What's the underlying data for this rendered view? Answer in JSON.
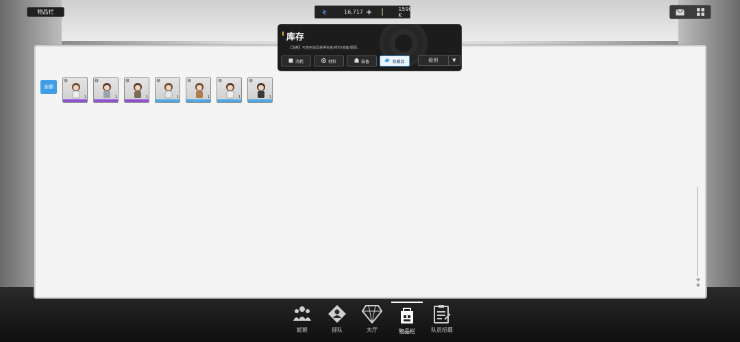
{
  "page_tag": "物品栏",
  "currency": {
    "energy_value": "16,717",
    "energy_plus": "+",
    "credit_value": "1590 K"
  },
  "top_right": {
    "mail_icon": "mail-icon",
    "grid_icon": "grid-icon"
  },
  "inventory": {
    "title": "库存",
    "description": "【消耗】可使用道具获得资金/材料/装备/姬姬。",
    "tabs": [
      {
        "label": "消耗",
        "icon": "consumable-icon",
        "active": false
      },
      {
        "label": "材料",
        "icon": "material-icon",
        "active": false
      },
      {
        "label": "装备",
        "icon": "equipment-icon",
        "active": false
      },
      {
        "label": "收藏品",
        "icon": "collection-icon",
        "active": true
      }
    ],
    "sort_label": "级别",
    "sort_arrow": "▼"
  },
  "filter": {
    "all_label": "全部"
  },
  "items": [
    {
      "rarity_color": "#8f4fd6",
      "level": "1"
    },
    {
      "rarity_color": "#8f4fd6",
      "level": "1"
    },
    {
      "rarity_color": "#8f4fd6",
      "level": "1"
    },
    {
      "rarity_color": "#4aa8e8",
      "level": "1"
    },
    {
      "rarity_color": "#4aa8e8",
      "level": "1"
    },
    {
      "rarity_color": "#4aa8e8",
      "level": "1"
    },
    {
      "rarity_color": "#4aa8e8",
      "level": "1"
    }
  ],
  "bottom_nav": [
    {
      "label": "妮姬",
      "icon": "nikke-icon",
      "active": false
    },
    {
      "label": "部队",
      "icon": "squad-icon",
      "active": false
    },
    {
      "label": "大厅",
      "icon": "lobby-icon",
      "active": false
    },
    {
      "label": "物品栏",
      "icon": "inventory-icon",
      "active": true
    },
    {
      "label": "队员招募",
      "icon": "recruit-icon",
      "active": false
    }
  ]
}
